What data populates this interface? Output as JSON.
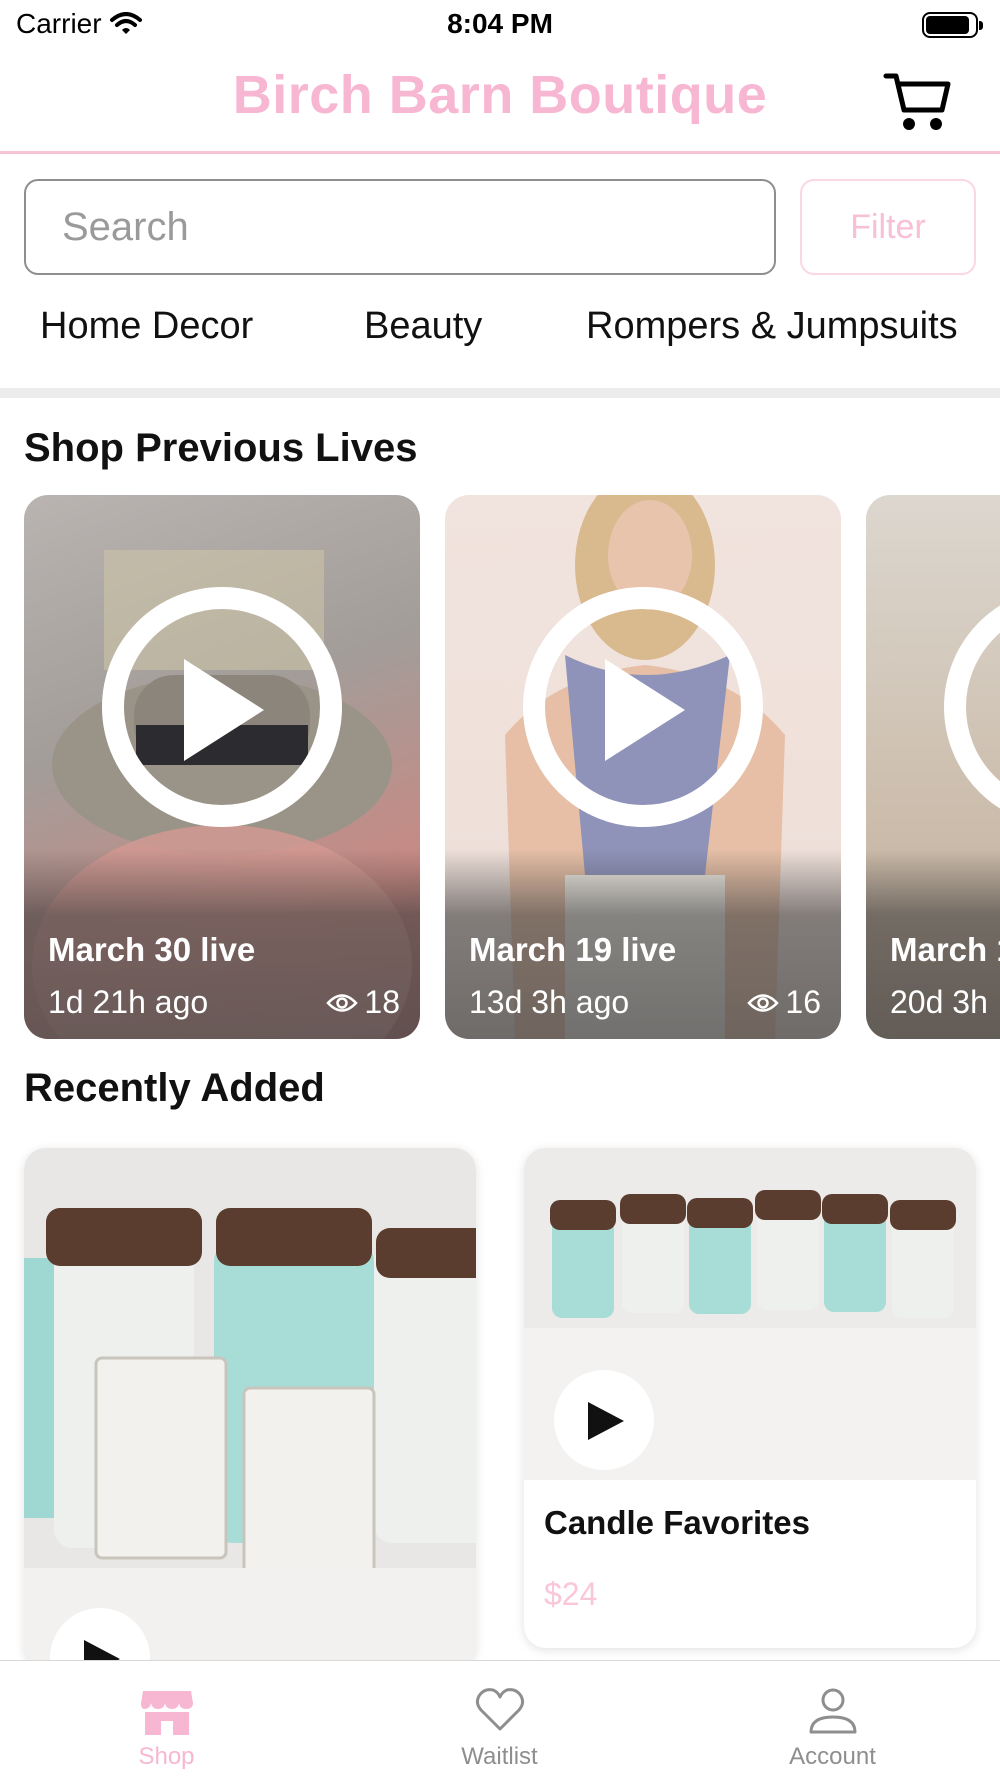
{
  "status_bar": {
    "carrier": "Carrier",
    "time": "8:04 PM",
    "battery_level": 0.9
  },
  "header": {
    "title": "Birch Barn Boutique",
    "cart_icon": "cart-icon"
  },
  "search": {
    "placeholder": "Search",
    "value": "",
    "filter_label": "Filter"
  },
  "categories": [
    "Home Decor",
    "Beauty",
    "Rompers & Jumpsuits"
  ],
  "lives_section": {
    "title": "Shop Previous Lives",
    "items": [
      {
        "title": "March 30 live",
        "ago": "1d 21h ago",
        "views": "18"
      },
      {
        "title": "March 19 live",
        "ago": "13d 3h ago",
        "views": "16"
      },
      {
        "title": "March 1",
        "ago": "20d 3h",
        "views": ""
      }
    ]
  },
  "recent_section": {
    "title": "Recently Added",
    "products": [
      {
        "name": "",
        "price": ""
      },
      {
        "name": "Candle Favorites",
        "price": "$24"
      }
    ]
  },
  "tab_bar": {
    "tabs": [
      {
        "label": "Shop",
        "icon": "shop-icon",
        "active": true
      },
      {
        "label": "Waitlist",
        "icon": "heart-icon",
        "active": false
      },
      {
        "label": "Account",
        "icon": "person-icon",
        "active": false
      }
    ]
  },
  "colors": {
    "brand_pink": "#f7b7d2",
    "divider": "#ececec",
    "inactive": "#8e8e8e"
  }
}
